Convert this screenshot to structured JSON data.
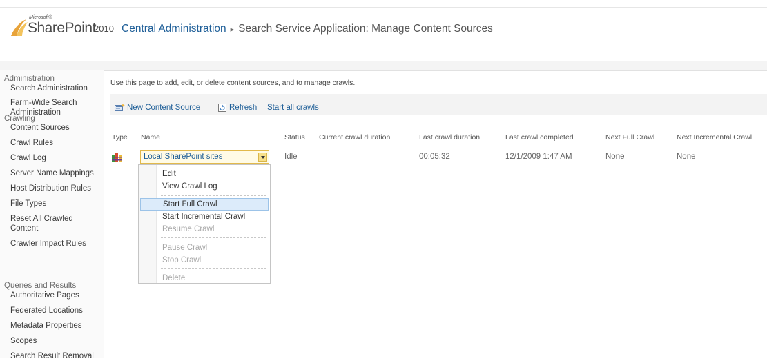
{
  "branding": {
    "microsoft": "Microsoft®",
    "product": "SharePoint",
    "year": "2010"
  },
  "title": {
    "crumb": "Central Administration",
    "separator": "▸",
    "page": "Search Service Application: Manage Content Sources"
  },
  "nav": {
    "admin_heading": "Administration",
    "admin_items": [
      "Search Administration",
      "Farm-Wide Search Administration"
    ],
    "crawling_heading": "Crawling",
    "crawling_items": [
      "Content Sources",
      "Crawl Rules",
      "Crawl Log",
      "Server Name Mappings",
      "Host Distribution Rules",
      "File Types",
      "Reset All Crawled Content",
      "Crawler Impact Rules"
    ],
    "queries_heading": "Queries and Results",
    "queries_items": [
      "Authoritative Pages",
      "Federated Locations",
      "Metadata Properties",
      "Scopes",
      "Search Result Removal"
    ]
  },
  "intro": "Use this page to add, edit, or delete content sources, and to manage crawls.",
  "toolbar": {
    "new_label": "New Content Source",
    "refresh_label": "Refresh",
    "start_all_label": "Start all crawls"
  },
  "table": {
    "headers": [
      "Type",
      "Name",
      "Status",
      "Current crawl duration",
      "Last crawl duration",
      "Last crawl completed",
      "Next Full Crawl",
      "Next Incremental Crawl"
    ],
    "row": {
      "type_icon": "content-source-icon",
      "name": "Local SharePoint sites",
      "status": "Idle",
      "current_duration": "",
      "last_duration": "00:05:32",
      "last_completed": "12/1/2009 1:47 AM",
      "next_full": "None",
      "next_incremental": "None"
    }
  },
  "menu": {
    "items": [
      "Edit",
      "View Crawl Log",
      "Start Full Crawl",
      "Start Incremental Crawl",
      "Resume Crawl",
      "Pause Crawl",
      "Stop Crawl",
      "Delete"
    ],
    "highlighted": "Start Full Crawl",
    "disabled": [
      "Resume Crawl",
      "Pause Crawl",
      "Stop Crawl",
      "Delete"
    ]
  },
  "colors": {
    "link": "#1f5f98",
    "menu_highlight": "#dcebfa",
    "dropdown_border": "#e2b94b"
  }
}
